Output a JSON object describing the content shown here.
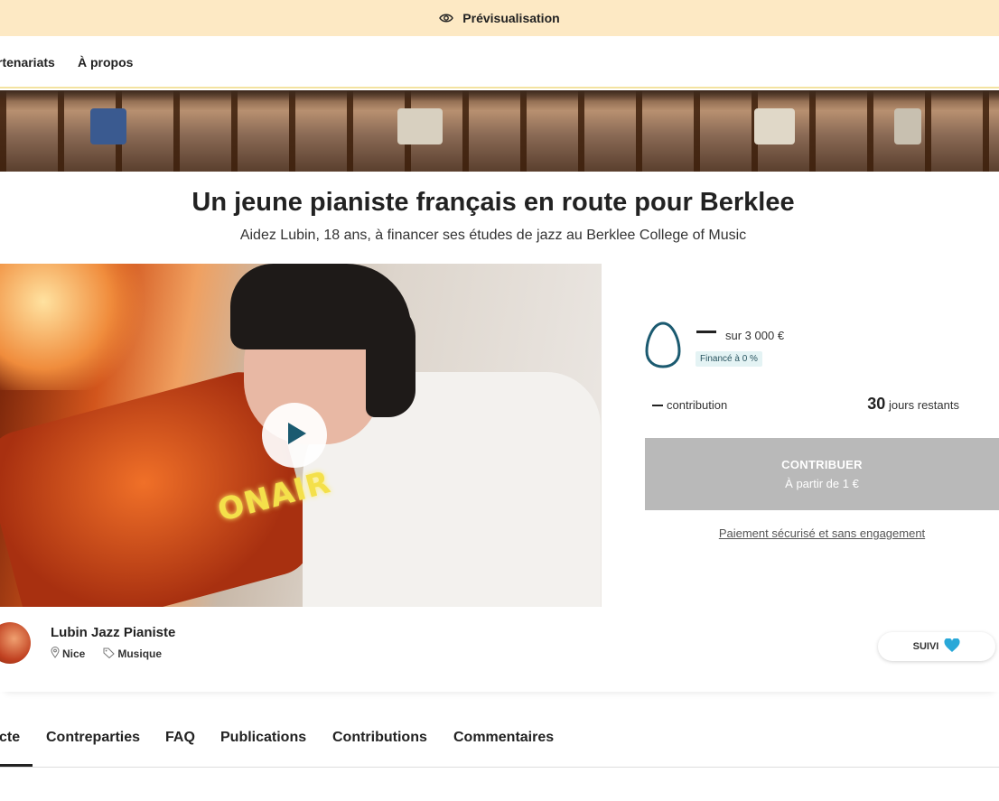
{
  "preview_bar": {
    "label": "Prévisualisation",
    "icon": "eye-icon"
  },
  "topnav": {
    "items": [
      "rtenariats",
      "À propos"
    ]
  },
  "project": {
    "title": "Un jeune pianiste français en route pour Berklee",
    "subtitle": "Aidez Lubin, 18 ans, à financer ses études de jazz au Berklee College of Music",
    "video_neon_text": "ONAIR"
  },
  "funding": {
    "goal": "sur 3 000 €",
    "funded_badge": "Financé à 0 %",
    "funded_fraction": 0,
    "contributions_label": "contribution",
    "days_number": "30",
    "days_label": "jours restants"
  },
  "contribute": {
    "main_label": "CONTRIBUER",
    "sub_label": "À partir de 1 €",
    "secure_link": "Paiement sécurisé et sans engagement"
  },
  "owner": {
    "name": "Lubin Jazz Pianiste",
    "location": "Nice",
    "category": "Musique",
    "follow_label": "SUIVI"
  },
  "tabs": [
    "cte",
    "Contreparties",
    "FAQ",
    "Publications",
    "Contributions",
    "Commentaires"
  ],
  "colors": {
    "preview_bg": "#fde9c4",
    "egg_stroke": "#1b5a70",
    "badge_bg": "#e4f3f4",
    "button_disabled": "#b9b9b9",
    "heart": "#29a8d8"
  }
}
